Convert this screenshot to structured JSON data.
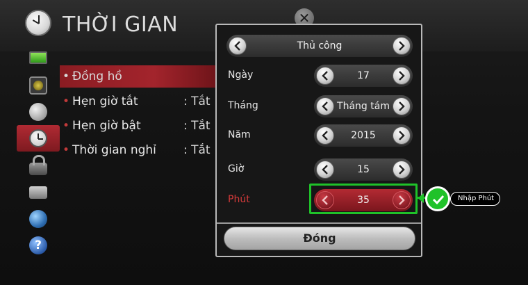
{
  "app": {
    "title": "THỜI GIAN"
  },
  "menu": {
    "items": [
      {
        "label": "Đồng hồ",
        "value": ""
      },
      {
        "label": "Hẹn giờ tắt",
        "value": ": Tắt"
      },
      {
        "label": "Hẹn giờ bật",
        "value": ": Tắt"
      },
      {
        "label": "Thời gian nghỉ",
        "value": ": Tắt"
      }
    ]
  },
  "sidebar": {
    "icons": [
      "screen-icon",
      "speaker-icon",
      "satellite-dish-icon",
      "clock-icon",
      "lock-icon",
      "box-icon",
      "globe-icon",
      "help-icon"
    ]
  },
  "dialog": {
    "mode": "Thủ công",
    "fields": [
      {
        "label": "Ngày",
        "value": "17"
      },
      {
        "label": "Tháng",
        "value": "Tháng tám"
      },
      {
        "label": "Năm",
        "value": "2015"
      },
      {
        "label": "Giờ",
        "value": "15"
      },
      {
        "label": "Phút",
        "value": "35"
      }
    ],
    "close_label": "Đóng"
  },
  "annotation": {
    "label": "Nhập Phút",
    "color": "#1fc229"
  },
  "colors": {
    "accent_red": "#a3242c",
    "highlight_green": "#1fc229"
  }
}
